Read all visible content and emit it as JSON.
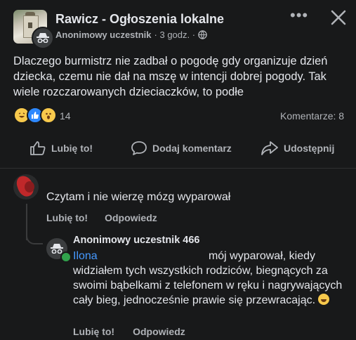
{
  "post": {
    "group_name": "Rawicz - Ogłoszenia lokalne",
    "author": "Anonimowy uczestnik",
    "time": "· 3 godz. ·",
    "body": "Dlaczego burmistrz nie zadbał o pogodę gdy organizuje dzień dziecka, czemu nie dał na mszę w intencji dobrej pogody. Tak wiele rozczarowanych dzieciaczków, to podłe",
    "reaction_count": "14",
    "comments_label": "Komentarze: 8",
    "actions": {
      "like": "Lubię to!",
      "comment": "Dodaj komentarz",
      "share": "Udostępnij"
    }
  },
  "comments": [
    {
      "text": "Czytam  i nie wierzę mózg wyparował",
      "like_label": "Lubię to!",
      "reply_label": "Odpowiedz"
    }
  ],
  "reply": {
    "author": "Anonimowy uczestnik 466",
    "mention": "Ilona",
    "first_line": "mój wyparował, kiedy",
    "rest": "widziałem tych wszystkich rodziców, biegnących za swoimi bąbelkami z telefonem w ręku i nagrywających cały bieg, jednocześnie prawie się przewracając.",
    "like_label": "Lubię to!",
    "reply_label": "Odpowiedz"
  },
  "icons": {
    "more": "ellipsis-icon",
    "close": "close-icon",
    "like": "thumbs-up-icon",
    "comment": "comment-bubble-icon",
    "share": "share-arrow-icon",
    "privacy": "globe-icon",
    "anonymous": "incognito-icon"
  },
  "colors": {
    "background": "#18191a",
    "text": "#e4e6eb",
    "secondary": "#b0b3b8",
    "mention": "#4599ff",
    "like_reaction": "#2d88ff",
    "online_badge": "#31a24c"
  }
}
